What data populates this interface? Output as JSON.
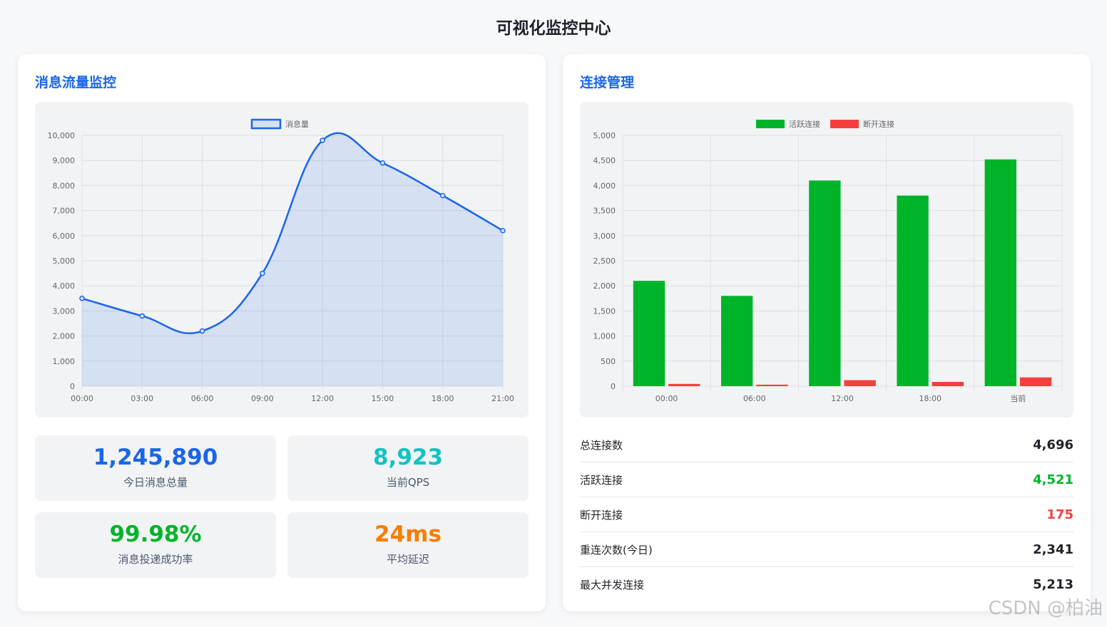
{
  "page": {
    "title": "可视化监控中心"
  },
  "left_panel": {
    "title": "消息流量监控",
    "stats": [
      {
        "value": "1,245,890",
        "label": "今日消息总量",
        "color": "#1a66e8"
      },
      {
        "value": "8,923",
        "label": "当前QPS",
        "color": "#13c2c2"
      },
      {
        "value": "99.98%",
        "label": "消息投递成功率",
        "color": "#00b42a"
      },
      {
        "value": "24ms",
        "label": "平均延迟",
        "color": "#fa7d00"
      }
    ]
  },
  "right_panel": {
    "title": "连接管理",
    "rows": [
      {
        "label": "总连接数",
        "value": "4,696",
        "color": "#1f2329"
      },
      {
        "label": "活跃连接",
        "value": "4,521",
        "color": "#00b42a"
      },
      {
        "label": "断开连接",
        "value": "175",
        "color": "#f53f3f"
      },
      {
        "label": "重连次数(今日)",
        "value": "2,341",
        "color": "#1f2329"
      },
      {
        "label": "最大并发连接",
        "value": "5,213",
        "color": "#1f2329"
      }
    ]
  },
  "chart_data": [
    {
      "type": "line",
      "x": [
        "00:00",
        "03:00",
        "06:00",
        "09:00",
        "12:00",
        "15:00",
        "18:00",
        "21:00"
      ],
      "series": [
        {
          "name": "消息量",
          "values": [
            3500,
            2800,
            2200,
            4500,
            9800,
            8900,
            7600,
            6200
          ],
          "color": "#1a66e8"
        }
      ],
      "ylim": [
        0,
        10000
      ],
      "yticks": [
        "0",
        "1,000",
        "2,000",
        "3,000",
        "4,000",
        "5,000",
        "6,000",
        "7,000",
        "8,000",
        "9,000",
        "10,000"
      ],
      "fill": true,
      "legend": "top-center",
      "grid": true
    },
    {
      "type": "bar",
      "categories": [
        "00:00",
        "06:00",
        "12:00",
        "18:00",
        "当前"
      ],
      "series": [
        {
          "name": "活跃连接",
          "values": [
            2100,
            1800,
            4100,
            3800,
            4521
          ],
          "color": "#00b42a"
        },
        {
          "name": "断开连接",
          "values": [
            45,
            30,
            120,
            85,
            175
          ],
          "color": "#f53f3f"
        }
      ],
      "ylim": [
        0,
        5000
      ],
      "yticks": [
        "0",
        "500",
        "1,000",
        "1,500",
        "2,000",
        "2,500",
        "3,000",
        "3,500",
        "4,000",
        "4,500",
        "5,000"
      ],
      "legend": "top-center",
      "grid": true
    }
  ],
  "watermark": "CSDN @柏油"
}
